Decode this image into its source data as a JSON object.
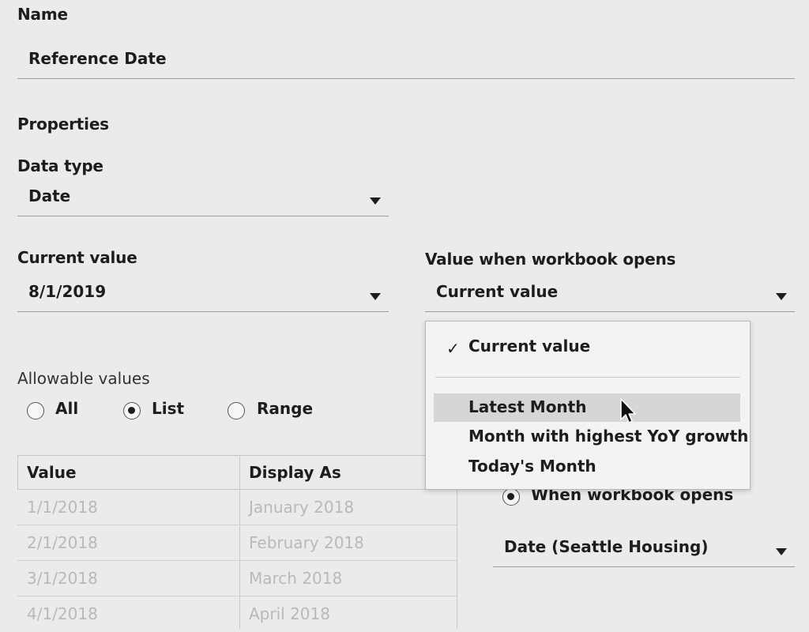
{
  "name_section": {
    "label": "Name",
    "value": "Reference Date"
  },
  "properties": {
    "heading": "Properties"
  },
  "data_type": {
    "label": "Data type",
    "value": "Date"
  },
  "current_value": {
    "label": "Current value",
    "value": "8/1/2019"
  },
  "workbook_opens": {
    "label": "Value when workbook opens",
    "value": "Current value"
  },
  "menu": {
    "checked_item": "Current value",
    "items": [
      "Latest Month",
      "Month with highest YoY growth",
      "Today's Month"
    ],
    "highlighted_index": 0
  },
  "allowable": {
    "label": "Allowable values",
    "options": [
      "All",
      "List",
      "Range"
    ],
    "selected": "List"
  },
  "table": {
    "headers": [
      "Value",
      "Display As"
    ],
    "rows": [
      [
        "1/1/2018",
        "January 2018"
      ],
      [
        "2/1/2018",
        "February 2018"
      ],
      [
        "3/1/2018",
        "March 2018"
      ],
      [
        "4/1/2018",
        "April 2018"
      ]
    ]
  },
  "refresh": {
    "option_label": "When workbook opens",
    "source_value": "Date (Seattle Housing)"
  }
}
